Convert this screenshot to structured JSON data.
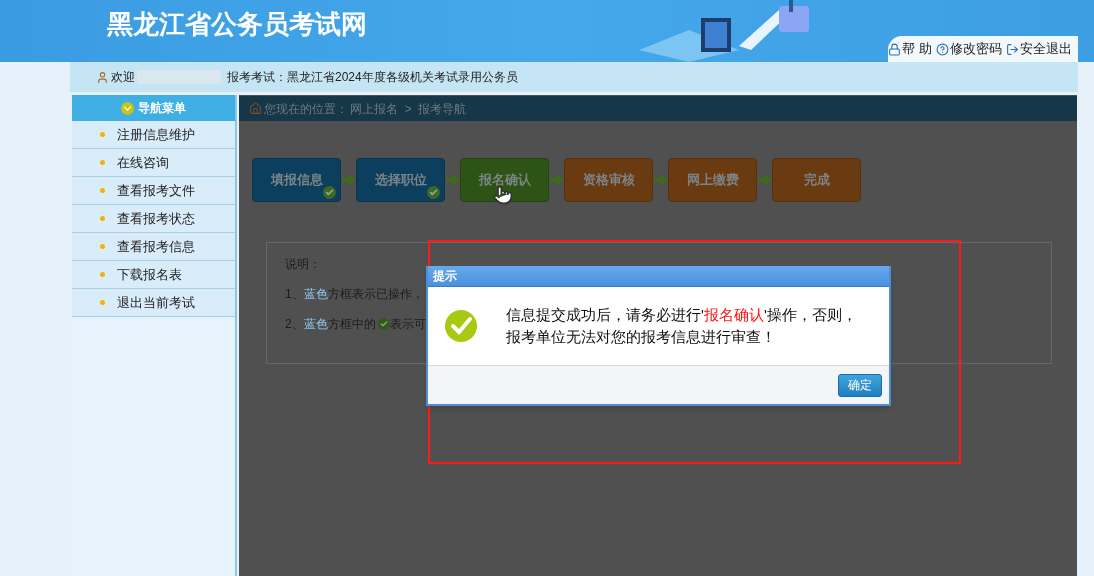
{
  "header": {
    "title": "黑龙江省公务员考试网",
    "links": [
      {
        "kind": "help",
        "label": "帮 助"
      },
      {
        "kind": "password",
        "label": "修改密码"
      },
      {
        "kind": "logout",
        "label": "安全退出"
      }
    ]
  },
  "welcome": {
    "greeting": "欢迎",
    "exam": "报考考试：黑龙江省2024年度各级机关考试录用公务员"
  },
  "sidebar": {
    "title": "导航菜单",
    "items": [
      "注册信息维护",
      "在线咨询",
      "查看报考文件",
      "查看报考状态",
      "查看报考信息",
      "下载报名表",
      "退出当前考试"
    ]
  },
  "breadcrumb": {
    "label": "您现在的位置：",
    "path": "网上报名  >  报考导航"
  },
  "steps": [
    {
      "label": "填报信息",
      "kind": "done",
      "checked": true
    },
    {
      "label": "选择职位",
      "kind": "done",
      "checked": true
    },
    {
      "label": "报名确认",
      "kind": "current",
      "checked": false
    },
    {
      "label": "资格审核",
      "kind": "pending",
      "checked": false
    },
    {
      "label": "网上缴费",
      "kind": "pending",
      "checked": false
    },
    {
      "label": "完成",
      "kind": "pending",
      "checked": false
    }
  ],
  "notes": {
    "title": "说明：",
    "lines": [
      {
        "number": "1、",
        "highlight": "蓝色",
        "text": "方框表示已操作，"
      },
      {
        "number": "2、",
        "highlight": "蓝色",
        "text": "方框中的",
        "after_icon": "表示可"
      }
    ]
  },
  "dialog": {
    "title": "提示",
    "message_before": "信息提交成功后，请务必进行'",
    "message_highlight": "报名确认",
    "message_after": "'操作，否则，报考单位无法对您的报考信息进行审查！",
    "button": "确定"
  }
}
